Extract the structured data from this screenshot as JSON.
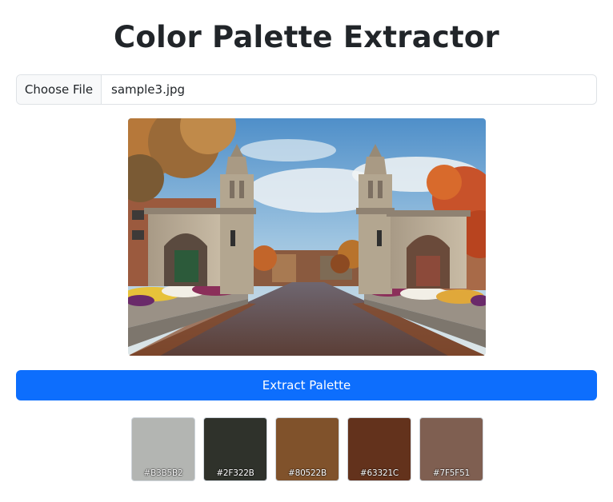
{
  "header": {
    "title": "Color Palette Extractor"
  },
  "file_input": {
    "button_label": "Choose File",
    "file_name": "sample3.jpg"
  },
  "preview": {
    "description": "photo"
  },
  "actions": {
    "extract_label": "Extract Palette"
  },
  "palette": [
    {
      "hex": "#B3B5B2",
      "label": "#B3B5B2"
    },
    {
      "hex": "#2F322B",
      "label": "#2F322B"
    },
    {
      "hex": "#80522B",
      "label": "#80522B"
    },
    {
      "hex": "#63321C",
      "label": "#63321C"
    },
    {
      "hex": "#7F5F51",
      "label": "#7F5F51"
    }
  ],
  "colors": {
    "primary": "#0d6efd",
    "border": "#dee2e6"
  }
}
